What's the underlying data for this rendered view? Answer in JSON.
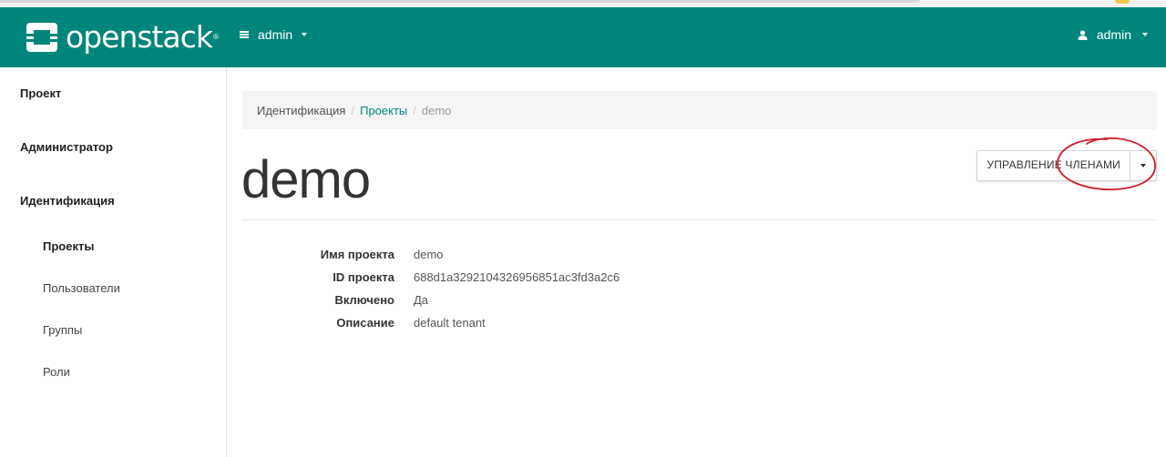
{
  "navbar": {
    "brand": "openstack",
    "brand_mark": "®",
    "project_switcher": "admin",
    "user": "admin",
    "color": "#00857c"
  },
  "sidebar": {
    "sections": [
      {
        "label": "Проект"
      },
      {
        "label": "Администратор"
      },
      {
        "label": "Идентификация"
      }
    ],
    "items": [
      {
        "label": "Проекты",
        "active": true
      },
      {
        "label": "Пользователи"
      },
      {
        "label": "Группы"
      },
      {
        "label": "Роли"
      }
    ]
  },
  "breadcrumb": {
    "items": [
      "Идентификация",
      "Проекты",
      "demo"
    ],
    "separator": "/"
  },
  "page": {
    "title": "demo",
    "action_button": "УПРАВЛЕНИЕ ЧЛЕНАМИ"
  },
  "details": [
    {
      "term": "Имя проекта",
      "value": "demo"
    },
    {
      "term": "ID проекта",
      "value": "688d1a3292104326956851ac3fd3a2c6"
    },
    {
      "term": "Включено",
      "value": "Да"
    },
    {
      "term": "Описание",
      "value": "default tenant"
    }
  ],
  "annotation_color": "#cc1f2b"
}
